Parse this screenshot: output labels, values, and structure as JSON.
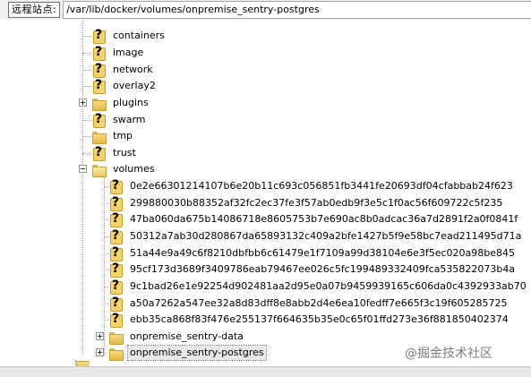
{
  "address_bar": {
    "label": "远程站点:",
    "path": "/var/lib/docker/volumes/onpremise_sentry-postgres"
  },
  "tree": {
    "top_items": [
      {
        "label": "containers",
        "icon": "question-icon"
      },
      {
        "label": "image",
        "icon": "question-icon"
      },
      {
        "label": "network",
        "icon": "question-icon"
      },
      {
        "label": "overlay2",
        "icon": "question-icon"
      },
      {
        "label": "plugins",
        "icon": "folder-icon",
        "expander": "plus"
      },
      {
        "label": "swarm",
        "icon": "question-icon"
      },
      {
        "label": "tmp",
        "icon": "folder-icon"
      },
      {
        "label": "trust",
        "icon": "question-icon"
      },
      {
        "label": "volumes",
        "icon": "folder-open-icon",
        "expander": "minus"
      }
    ],
    "volume_children": [
      {
        "label": "0e2e66301214107b6e20b11c693c056851fb3441fe20693df04cfabbab24f623",
        "icon": "question-icon"
      },
      {
        "label": "299880030b88352af32fc2ec37fe3f57ab0edb9f3e5c1f0ac56f609722c5f235",
        "icon": "question-icon"
      },
      {
        "label": "47ba060da675b14086718e8605753b7e690ac8b0adcac36a7d2891f2a0f0841f",
        "icon": "question-icon"
      },
      {
        "label": "50312a7ab30d280867da65893132c409a2bfe1427b5f9e58bc7ead211495d71a",
        "icon": "question-icon"
      },
      {
        "label": "51a44e9a49c6f8210dbfbb6c61479e1f7109a99d38104e6e3f5ec020a98be845",
        "icon": "question-icon"
      },
      {
        "label": "95cf173d3689f3409786eab79467ee026c5fc199489332409fca535822073b4a",
        "icon": "question-icon"
      },
      {
        "label": "9c1bad26e1e92254d902481aa2d95e0a07b9459939165c606da0c4392933ab70",
        "icon": "question-icon"
      },
      {
        "label": "a50a7262a547ee32a8d83dff8e8abb2d4e6ea10fedff7e665f3c19f605285725",
        "icon": "question-icon"
      },
      {
        "label": "ebb35ca868f83f476e255137f664635b35e0c65f01ffd273e36f881850402374",
        "icon": "question-icon"
      },
      {
        "label": "onpremise_sentry-data",
        "icon": "folder-icon",
        "expander": "plus"
      },
      {
        "label": "onpremise_sentry-postgres",
        "icon": "folder-icon",
        "expander": "plus",
        "selected": true
      }
    ]
  },
  "watermark": "@掘金技术社区"
}
